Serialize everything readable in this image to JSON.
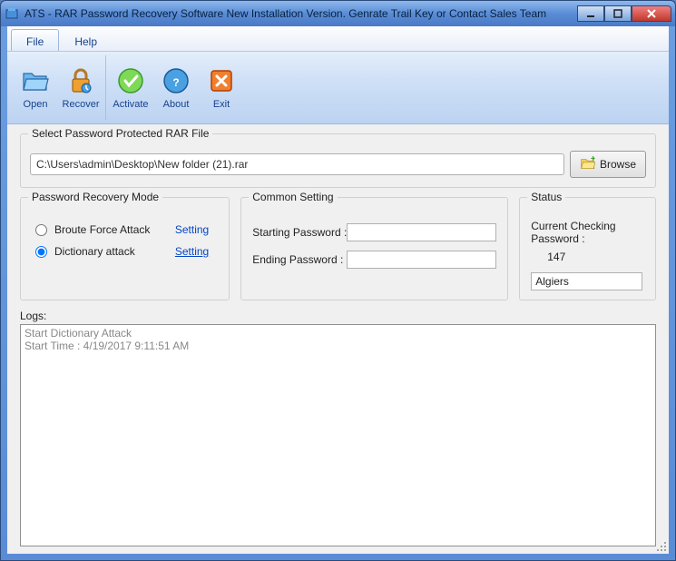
{
  "window": {
    "title": "ATS - RAR Password Recovery Software New Installation Version. Genrate Trail Key or Contact Sales Team"
  },
  "menu": {
    "file": "File",
    "help": "Help"
  },
  "toolbar": {
    "open": "Open",
    "recover": "Recover",
    "activate": "Activate",
    "about": "About",
    "exit": "Exit"
  },
  "file_select": {
    "legend": "Select Password Protected RAR File",
    "path": "C:\\Users\\admin\\Desktop\\New folder (21).rar",
    "browse": "Browse"
  },
  "mode": {
    "legend": "Password Recovery Mode",
    "brute": "Broute Force Attack",
    "dictionary": "Dictionary attack",
    "setting": "Setting",
    "selected": "dictionary"
  },
  "common": {
    "legend": "Common Setting",
    "starting": "Starting Password :",
    "ending": "Ending Password :",
    "starting_value": "",
    "ending_value": ""
  },
  "status": {
    "legend": "Status",
    "checking_label": "Current Checking Password :",
    "checking_count": "147",
    "current": "Algiers"
  },
  "logs": {
    "label": "Logs:",
    "text": "Start Dictionary Attack\nStart Time : 4/19/2017 9:11:51 AM"
  }
}
